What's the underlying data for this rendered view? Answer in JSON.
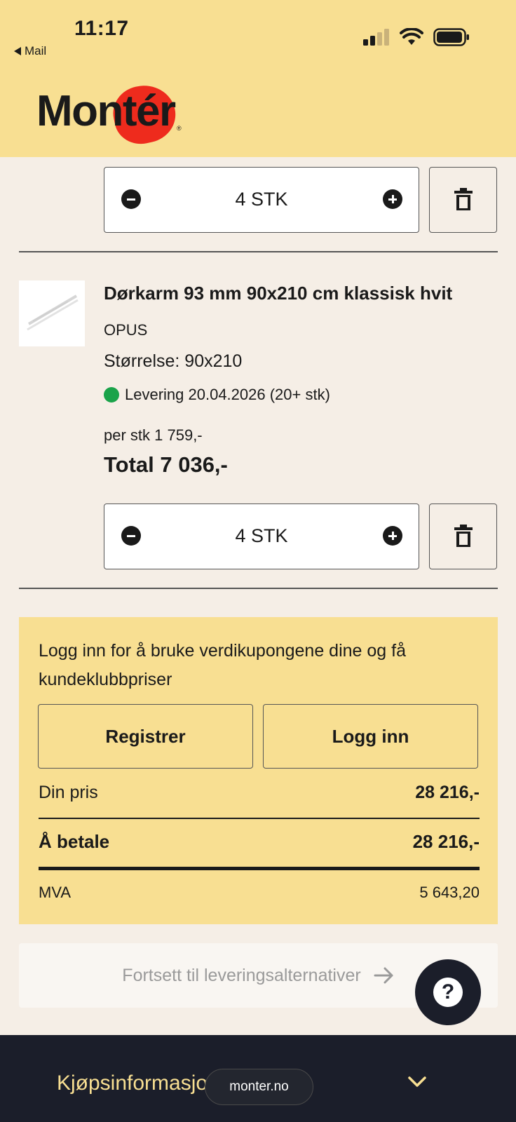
{
  "status_bar": {
    "time": "11:17",
    "back_app": "Mail"
  },
  "brand": {
    "logo_text": "Montér",
    "registered_mark": "®",
    "accent_color": "#ee2b1d",
    "header_color": "#f8df92"
  },
  "cart": {
    "items": [
      {
        "quantity_label": "4 STK"
      },
      {
        "title": "Dørkarm 93 mm 90x210 cm klassisk hvit",
        "brand": "OPUS",
        "size": "Størrelse: 90x210",
        "delivery": "Levering 20.04.2026 (20+ stk)",
        "delivery_status_color": "#1aa34a",
        "unit_price": "per stk 1 759,-",
        "total": "Total 7 036,-",
        "quantity_label": "4 STK"
      }
    ]
  },
  "login_panel": {
    "message": "Logg inn for å bruke verdikupongene dine og få kundeklubbpriser",
    "register_label": "Registrer",
    "login_label": "Logg inn",
    "your_price_label": "Din pris",
    "your_price_value": "28 216,-",
    "to_pay_label": "Å betale",
    "to_pay_value": "28 216,-",
    "vat_label": "MVA",
    "vat_value": "5 643,20"
  },
  "continue_label": "Fortsett til leveringsalternativer",
  "help_label": "?",
  "footer": {
    "title": "Kjøpsinformasjon",
    "url": "monter.no"
  }
}
